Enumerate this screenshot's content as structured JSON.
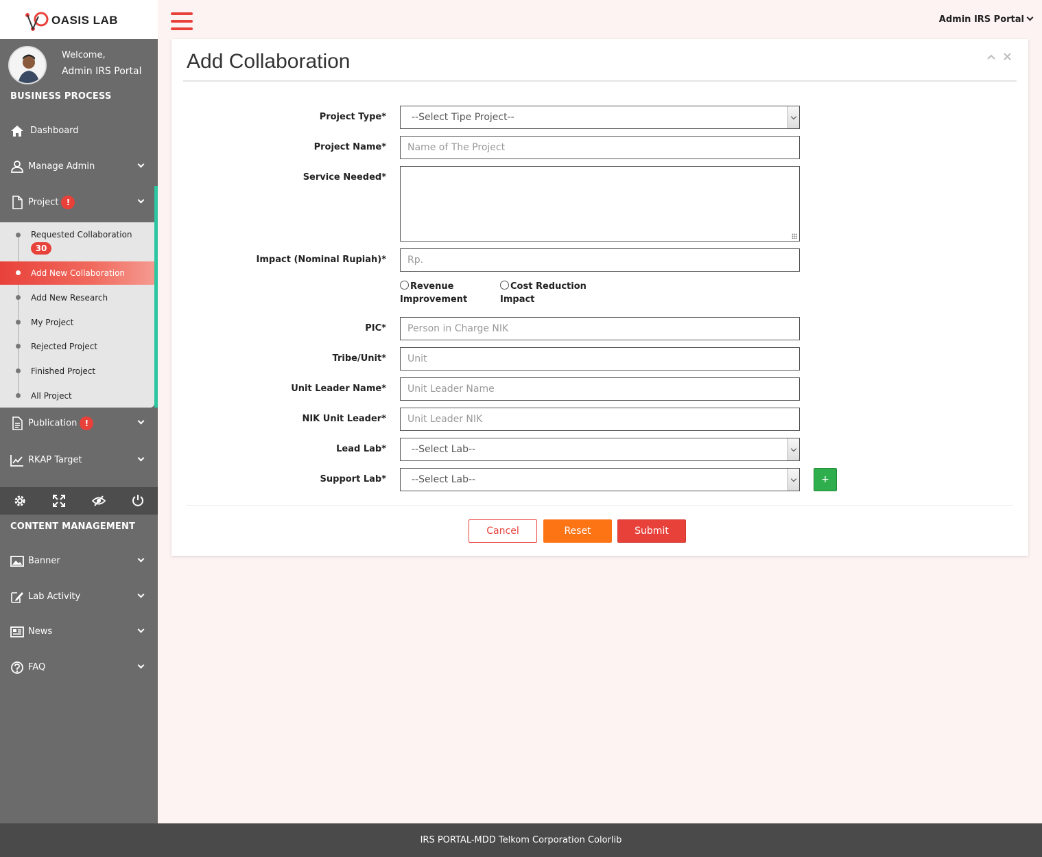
{
  "brand": {
    "name": "OASIS LAB"
  },
  "header": {
    "user_menu": "Admin IRS Portal"
  },
  "sidebar": {
    "welcome": "Welcome,",
    "user_name": "Admin IRS Portal",
    "business_section": "BUSINESS PROCESS",
    "items": {
      "dashboard": "Dashboard",
      "manage_admin": "Manage Admin",
      "project": "Project",
      "publication": "Publication",
      "rkap": "RKAP Target",
      "banner": "Banner",
      "lab_activity": "Lab Activity",
      "news": "News",
      "faq": "FAQ"
    },
    "alert_glyph": "!",
    "project_submenu": {
      "requested": "Requested Collaboration",
      "requested_count": "30",
      "add_collab": "Add New Collaboration",
      "add_research": "Add New Research",
      "my_project": "My Project",
      "rejected": "Rejected Project",
      "finished": "Finished Project",
      "all": "All Project"
    },
    "content_section": "CONTENT MANAGEMENT",
    "tools": [
      "gear-icon",
      "expand-icon",
      "eye-off-icon",
      "power-icon"
    ]
  },
  "form": {
    "title": "Add Collaboration",
    "project_type": {
      "label": "Project Type*",
      "value": "--Select Tipe Project--"
    },
    "project_name": {
      "label": "Project Name*",
      "placeholder": "Name of The Project"
    },
    "service_needed": {
      "label": "Service Needed*"
    },
    "impact": {
      "label": "Impact (Nominal Rupiah)*",
      "placeholder": "Rp."
    },
    "radio_revenue": "Revenue Improvement",
    "radio_revenue_l1": "Revenue",
    "radio_revenue_l2": "Improvement",
    "radio_cost_l1": "Cost Reduction",
    "radio_cost_l2": "Impact",
    "pic": {
      "label": "PIC*",
      "placeholder": "Person in Charge NIK"
    },
    "tribe": {
      "label": "Tribe/Unit*",
      "placeholder": "Unit"
    },
    "leader_name": {
      "label": "Unit Leader Name*",
      "placeholder": "Unit Leader Name"
    },
    "nik_leader": {
      "label": "NIK Unit Leader*",
      "placeholder": "Unit Leader NIK"
    },
    "lead_lab": {
      "label": "Lead Lab*",
      "value": "--Select Lab--"
    },
    "support_lab": {
      "label": "Support Lab*",
      "value": "--Select Lab--"
    },
    "add_lab": "+",
    "buttons": {
      "cancel": "Cancel",
      "reset": "Reset",
      "submit": "Submit"
    }
  },
  "footer": {
    "text": "IRS PORTAL-MDD Telkom Corporation Colorlib"
  },
  "colors": {
    "accent": "#e8413a",
    "orange": "#fd7415",
    "green": "#2eae4c",
    "sidebar": "#6b6b6b",
    "teal": "#2cc7a0"
  }
}
